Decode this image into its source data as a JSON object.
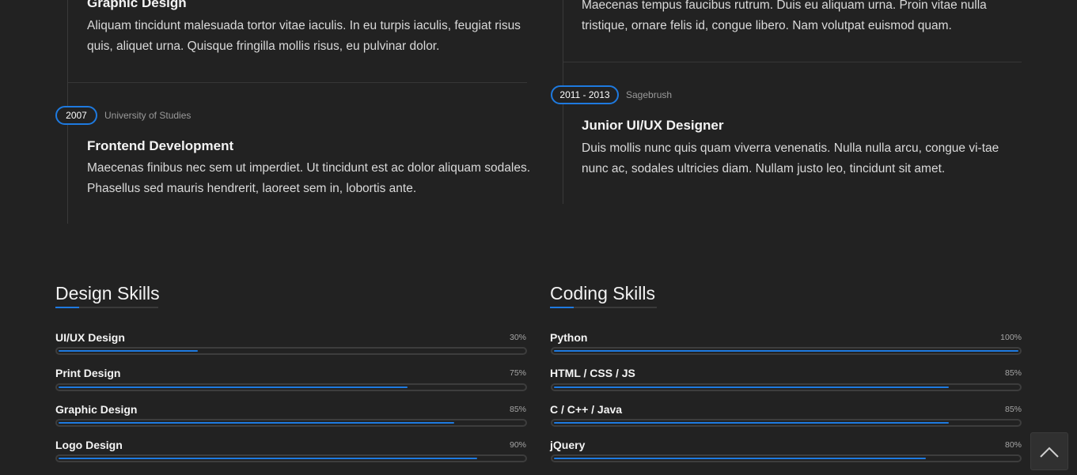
{
  "timeline_left": {
    "item_1": {
      "title": "Graphic Design",
      "description": "Aliquam tincidunt malesuada tortor vitae iaculis. In eu turpis iaculis, feugiat risus quis, aliquet urna. Quisque fringilla mollis risus, eu pulvinar dolor."
    },
    "item_2": {
      "period": "2007",
      "org": "University of Studies",
      "title": "Frontend Development",
      "description": "Maecenas finibus nec sem ut imperdiet. Ut tincidunt est ac dolor aliquam sodales. Phasellus sed mauris hendrerit, laoreet sem in, lobortis ante."
    }
  },
  "timeline_right": {
    "item_1": {
      "description": "Maecenas tempus faucibus rutrum. Duis eu aliquam urna. Proin vitae nulla tristique, ornare felis id, congue libero. Nam volutpat euismod quam."
    },
    "item_2": {
      "period": "2011 - 2013",
      "org": "Sagebrush",
      "title": "Junior UI/UX Designer",
      "description": "Duis mollis nunc quis quam viverra venenatis. Nulla nulla arcu, congue vi-tae nunc ac, sodales ultricies diam. Nullam justo leo, tincidunt sit amet."
    }
  },
  "design_skills": {
    "title": "Design Skills",
    "items": [
      {
        "name": "UI/UX Design",
        "percent_label": "30%",
        "value": 30
      },
      {
        "name": "Print Design",
        "percent_label": "75%",
        "value": 75
      },
      {
        "name": "Graphic Design",
        "percent_label": "85%",
        "value": 85
      },
      {
        "name": "Logo Design",
        "percent_label": "90%",
        "value": 90
      }
    ]
  },
  "coding_skills": {
    "title": "Coding Skills",
    "items": [
      {
        "name": "Python",
        "percent_label": "100%",
        "value": 100
      },
      {
        "name": "HTML / CSS / JS",
        "percent_label": "85%",
        "value": 85
      },
      {
        "name": "C / C++ / Java",
        "percent_label": "85%",
        "value": 85
      },
      {
        "name": "jQuery",
        "percent_label": "80%",
        "value": 80
      }
    ]
  },
  "colors": {
    "background": "#222222",
    "accent": "#1e7ae0",
    "text": "#e9e9e9"
  },
  "icons": {
    "back_to_top": "chevron-up-icon"
  }
}
